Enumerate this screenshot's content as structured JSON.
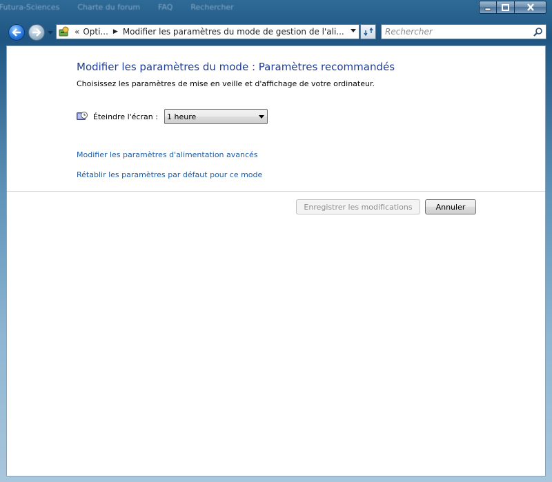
{
  "background_tabs": [
    "sur Futura-Sciences",
    "Charte du forum",
    "FAQ",
    "Rechercher"
  ],
  "window": {
    "caption_buttons": [
      "minimize-icon",
      "maximize-icon",
      "close-icon"
    ]
  },
  "navbar": {
    "breadcrumb": {
      "overflow": "«",
      "item1": "Opti...",
      "separator": "▶",
      "item2": "Modifier les paramètres du mode de gestion de l'ali..."
    },
    "search_placeholder": "Rechercher"
  },
  "page": {
    "title": "Modifier les paramètres du mode : Paramètres recommandés",
    "subtitle": "Choisissez les paramètres de mise en veille et d'affichage de votre ordinateur.",
    "display_off_label": "Éteindre l'écran :",
    "display_off_value": "1 heure",
    "link_advanced": "Modifier les paramètres d'alimentation avancés",
    "link_restore": "Rétablir les paramètres par défaut pour ce mode",
    "save_button": "Enregistrer les modifications",
    "cancel_button": "Annuler"
  },
  "colors": {
    "title": "#1e3c96",
    "link": "#1c5ba6",
    "disabled_text": "#8d8d8d"
  }
}
